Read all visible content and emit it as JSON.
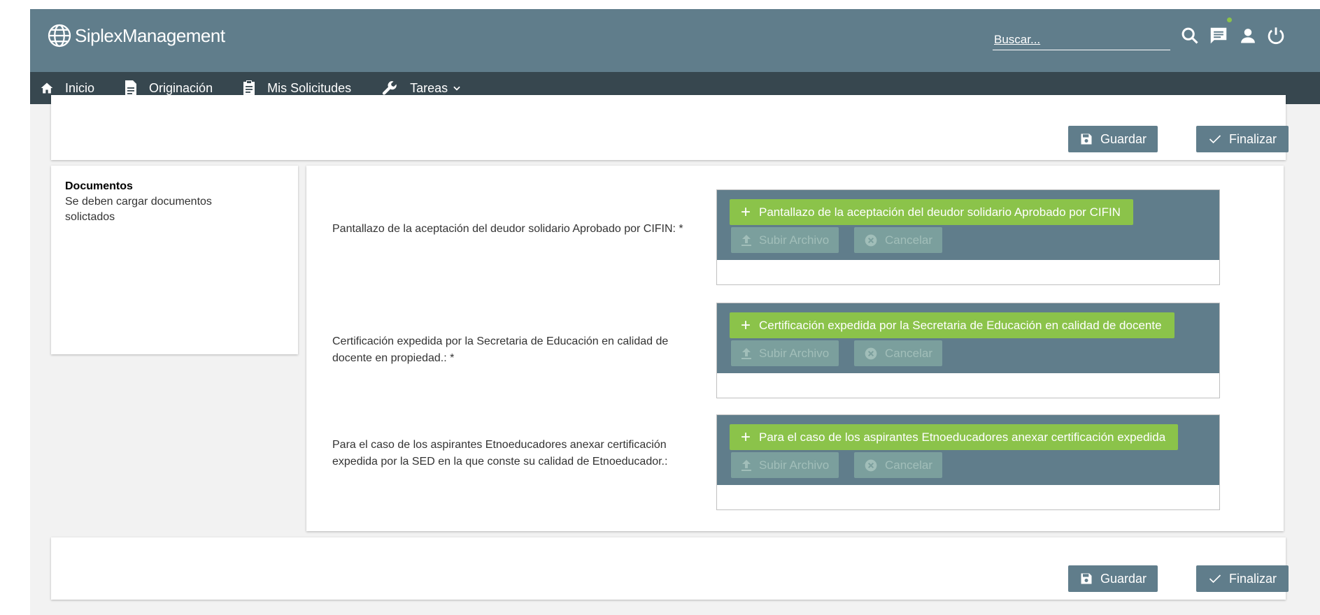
{
  "app": {
    "brand": "SiplexManagement"
  },
  "search": {
    "placeholder": "Buscar..."
  },
  "colors": {
    "header": "#607d8b",
    "nav": "#37474f",
    "accent_green": "#8bc34a"
  },
  "nav": {
    "items": [
      {
        "label": "Inicio",
        "icon": "home-icon"
      },
      {
        "label": "Originación",
        "icon": "document-icon"
      },
      {
        "label": "Mis Solicitudes",
        "icon": "clipboard-icon"
      },
      {
        "label": "Tareas",
        "icon": "wrench-icon"
      }
    ]
  },
  "actions": {
    "save_label": "Guardar",
    "finish_label": "Finalizar"
  },
  "sidebar": {
    "title": "Documentos",
    "description": "Se deben cargar documentos solictados"
  },
  "documents": [
    {
      "label": "Pantallazo de la aceptación del deudor solidario Aprobado por CIFIN: *",
      "choose_label": "Pantallazo de la aceptación del deudor solidario Aprobado por CIFIN",
      "upload_label": "Subir Archivo",
      "cancel_label": "Cancelar"
    },
    {
      "label": "Certificación expedida por la Secretaria de Educación en calidad de docente en propiedad.: *",
      "choose_label": "Certificación expedida por la Secretaria de Educación en calidad de docente",
      "upload_label": "Subir Archivo",
      "cancel_label": "Cancelar"
    },
    {
      "label": "Para el caso de los aspirantes Etnoeducadores anexar certificación expedida por la SED en la que conste su calidad de Etnoeducador.:",
      "choose_label": "Para el caso de los aspirantes Etnoeducadores anexar certificación expedida",
      "upload_label": "Subir Archivo",
      "cancel_label": "Cancelar"
    }
  ]
}
